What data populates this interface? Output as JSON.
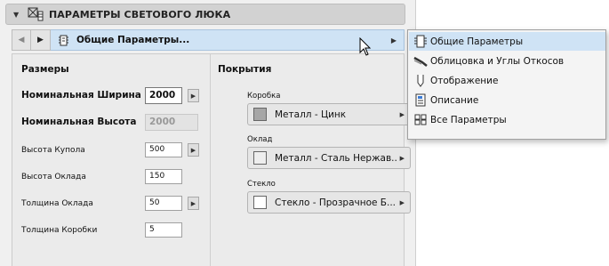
{
  "panel": {
    "title": "ПАРАМЕТРЫ СВЕТОВОГО ЛЮКА",
    "nav": {
      "back_glyph": "◀",
      "forward_glyph": "▶",
      "selected_page": "Общие Параметры...",
      "selected_icon": "general-settings-icon"
    }
  },
  "sizes": {
    "title": "Размеры",
    "rows": [
      {
        "label": "Номинальная Ширина",
        "value": "2000"
      },
      {
        "label": "Номинальная Высота",
        "value": "2000"
      },
      {
        "label": "Высота Купола",
        "value": "500"
      },
      {
        "label": "Высота Оклада",
        "value": "150"
      },
      {
        "label": "Толщина Оклада",
        "value": "50"
      },
      {
        "label": "Толщина Коробки",
        "value": "5"
      }
    ]
  },
  "surfaces": {
    "title": "Покрытия",
    "items": [
      {
        "label": "Коробка",
        "value": "Металл - Цинк",
        "swatch": "#a6a6a6"
      },
      {
        "label": "Оклад",
        "value": "Металл - Сталь Нержав...",
        "swatch": "#eeeeee"
      },
      {
        "label": "Стекло",
        "value": "Стекло - Прозрачное Б...",
        "swatch": "#ffffff"
      }
    ]
  },
  "menu": {
    "items": [
      {
        "label": "Общие Параметры",
        "icon": "general-settings-icon",
        "active": true
      },
      {
        "label": "Облицовка и Углы Откосов",
        "icon": "cladding-icon",
        "active": false
      },
      {
        "label": "Отображение",
        "icon": "display-icon",
        "active": false
      },
      {
        "label": "Описание",
        "icon": "description-icon",
        "active": false
      },
      {
        "label": "Все Параметры",
        "icon": "all-parameters-icon",
        "active": false
      }
    ]
  },
  "colors": {
    "highlight": "#cfe3f5",
    "header_bg": "#d2d2d2"
  }
}
